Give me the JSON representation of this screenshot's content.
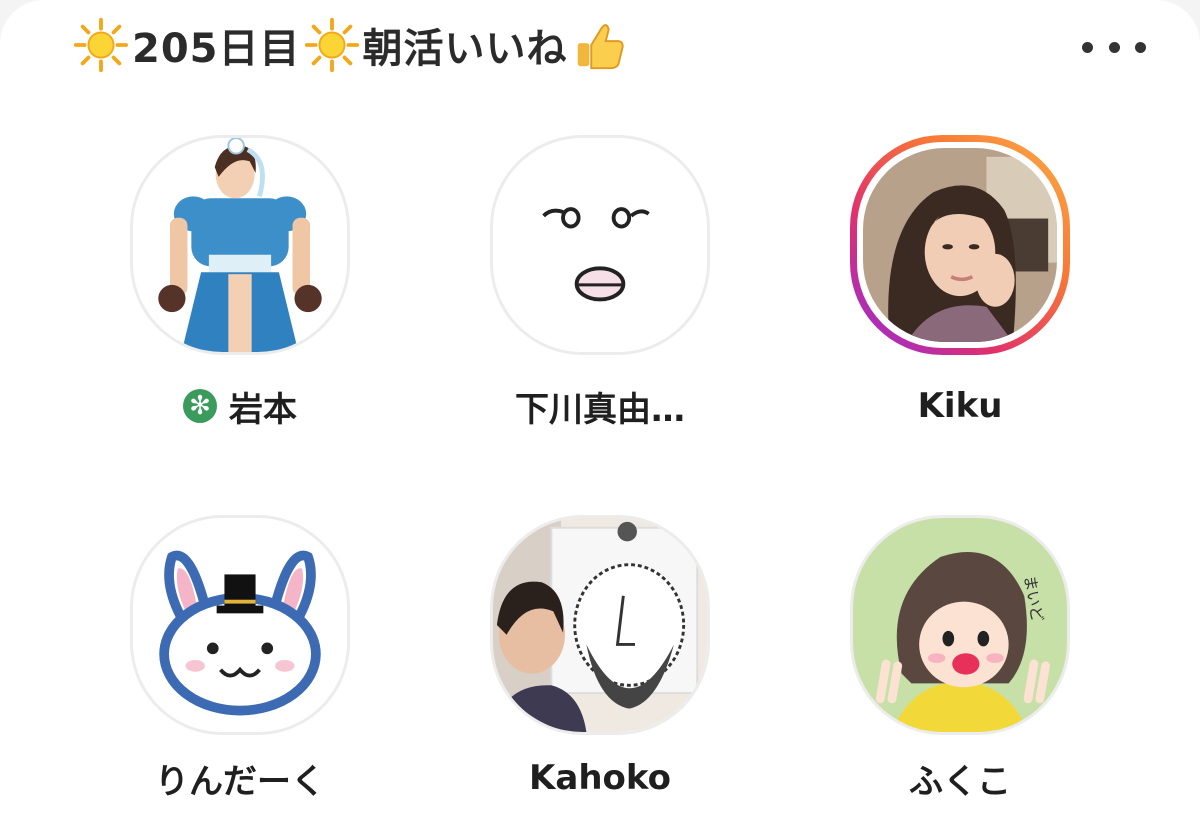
{
  "header": {
    "title_left": "205日目",
    "title_right": "朝活いいね",
    "icons": [
      "sun-emoji",
      "sun-emoji",
      "thumbs-up-emoji"
    ],
    "more_icon": "more-horizontal-icon"
  },
  "members": [
    {
      "name": "岩本",
      "avatar": "fighter-illustration",
      "verified": true
    },
    {
      "name": "下川真由…",
      "avatar": "face-doodle",
      "verified": false
    },
    {
      "name": "Kiku",
      "avatar": "woman-photo",
      "verified": false,
      "story_ring": true
    },
    {
      "name": "りんだーく",
      "avatar": "rabbit-tophat-illustration",
      "verified": false
    },
    {
      "name": "Kahoko",
      "avatar": "woman-with-bearded-drawing",
      "verified": false
    },
    {
      "name": "ふくこ",
      "avatar": "girl-peace-illustration",
      "verified": false
    }
  ],
  "colors": {
    "verified_badge": "#3a9b5c",
    "story_ring": [
      "#8e2de2",
      "#e1306c",
      "#f77737",
      "#fcaf45"
    ]
  }
}
